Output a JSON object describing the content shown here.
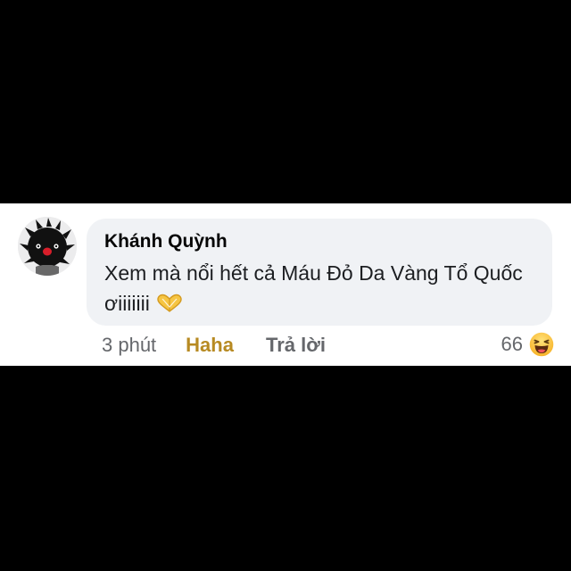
{
  "comment": {
    "author": "Khánh Quỳnh",
    "text": "Xem mà nổi hết cả Máu Đỏ Da Vàng Tổ Quốc ơiiiiiii",
    "emoji_icon": "heart-hands-icon"
  },
  "actions": {
    "time": "3 phút",
    "reaction_label": "Haha",
    "reply_label": "Trả lời"
  },
  "reactions": {
    "count": "66",
    "icon": "haha-emoji-icon"
  },
  "colors": {
    "background": "#000000",
    "panel": "#ffffff",
    "bubble": "#f0f2f5",
    "haha_accent": "#b78a22",
    "muted_text": "#65676b"
  }
}
